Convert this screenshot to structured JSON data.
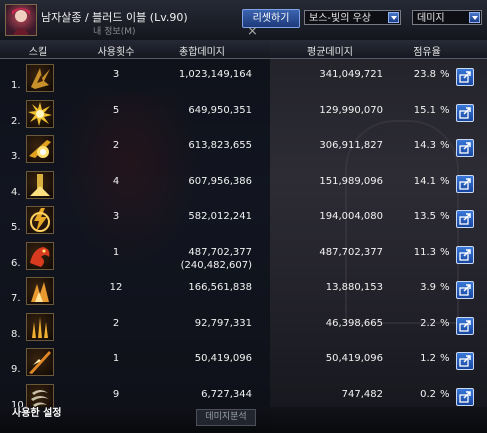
{
  "window": {
    "title": "남자살종 / 블러드 이블 (Lv.90)",
    "subtitle": "내 정보(M)",
    "reset_label": "리셋하기",
    "boss_select": "보스-빛의 우상",
    "metric_select": "데미지",
    "close_glyph": "×"
  },
  "table": {
    "headers": {
      "skill": "스킬",
      "count": "사용횟수",
      "total": "총합데미지",
      "average": "평균데미지",
      "share": "점유율"
    },
    "percent_sign": "%",
    "rows": [
      {
        "rank": "1.",
        "count": "3",
        "total": "1,023,149,164",
        "average": "341,049,721",
        "share": "23.8",
        "icon": "blade-burst-icon",
        "color": "#c8902a"
      },
      {
        "rank": "2.",
        "count": "5",
        "total": "649,950,351",
        "average": "129,990,070",
        "share": "15.1",
        "icon": "spiked-sun-icon",
        "color": "#f0c030"
      },
      {
        "rank": "3.",
        "count": "2",
        "total": "613,823,655",
        "average": "306,911,827",
        "share": "14.3",
        "icon": "slash-explosion-icon",
        "color": "#e0a020"
      },
      {
        "rank": "4.",
        "count": "4",
        "total": "607,956,386",
        "average": "151,989,096",
        "share": "14.1",
        "icon": "pillar-strike-icon",
        "color": "#d8b040"
      },
      {
        "rank": "5.",
        "count": "3",
        "total": "582,012,241",
        "average": "194,004,080",
        "share": "13.5",
        "icon": "lightning-swirl-icon",
        "color": "#e8a828"
      },
      {
        "rank": "6.",
        "count": "1",
        "total": "487,702,377",
        "total_extra": "(240,482,607)",
        "average": "487,702,377",
        "share": "11.3",
        "icon": "blood-dragon-icon",
        "color": "#d83a20"
      },
      {
        "rank": "7.",
        "count": "12",
        "total": "166,561,838",
        "average": "13,880,153",
        "share": "3.9",
        "icon": "rising-fang-icon",
        "color": "#e89a30"
      },
      {
        "rank": "8.",
        "count": "2",
        "total": "92,797,331",
        "average": "46,398,665",
        "share": "2.2",
        "icon": "claw-rise-icon",
        "color": "#f0b030"
      },
      {
        "rank": "9.",
        "count": "1",
        "total": "50,419,096",
        "average": "50,419,096",
        "share": "1.2",
        "icon": "diagonal-cut-icon",
        "color": "#e08828"
      },
      {
        "rank": "10.",
        "count": "9",
        "total": "6,727,344",
        "average": "747,482",
        "share": "0.2",
        "icon": "whirlwind-icon",
        "color": "#c8c0a8"
      }
    ]
  },
  "footer": {
    "settings_label": "사용한 설정",
    "detail_label": "데미지분석"
  },
  "colors": {
    "accent": "#3a78d8",
    "header_bg": "#1c1f28"
  }
}
